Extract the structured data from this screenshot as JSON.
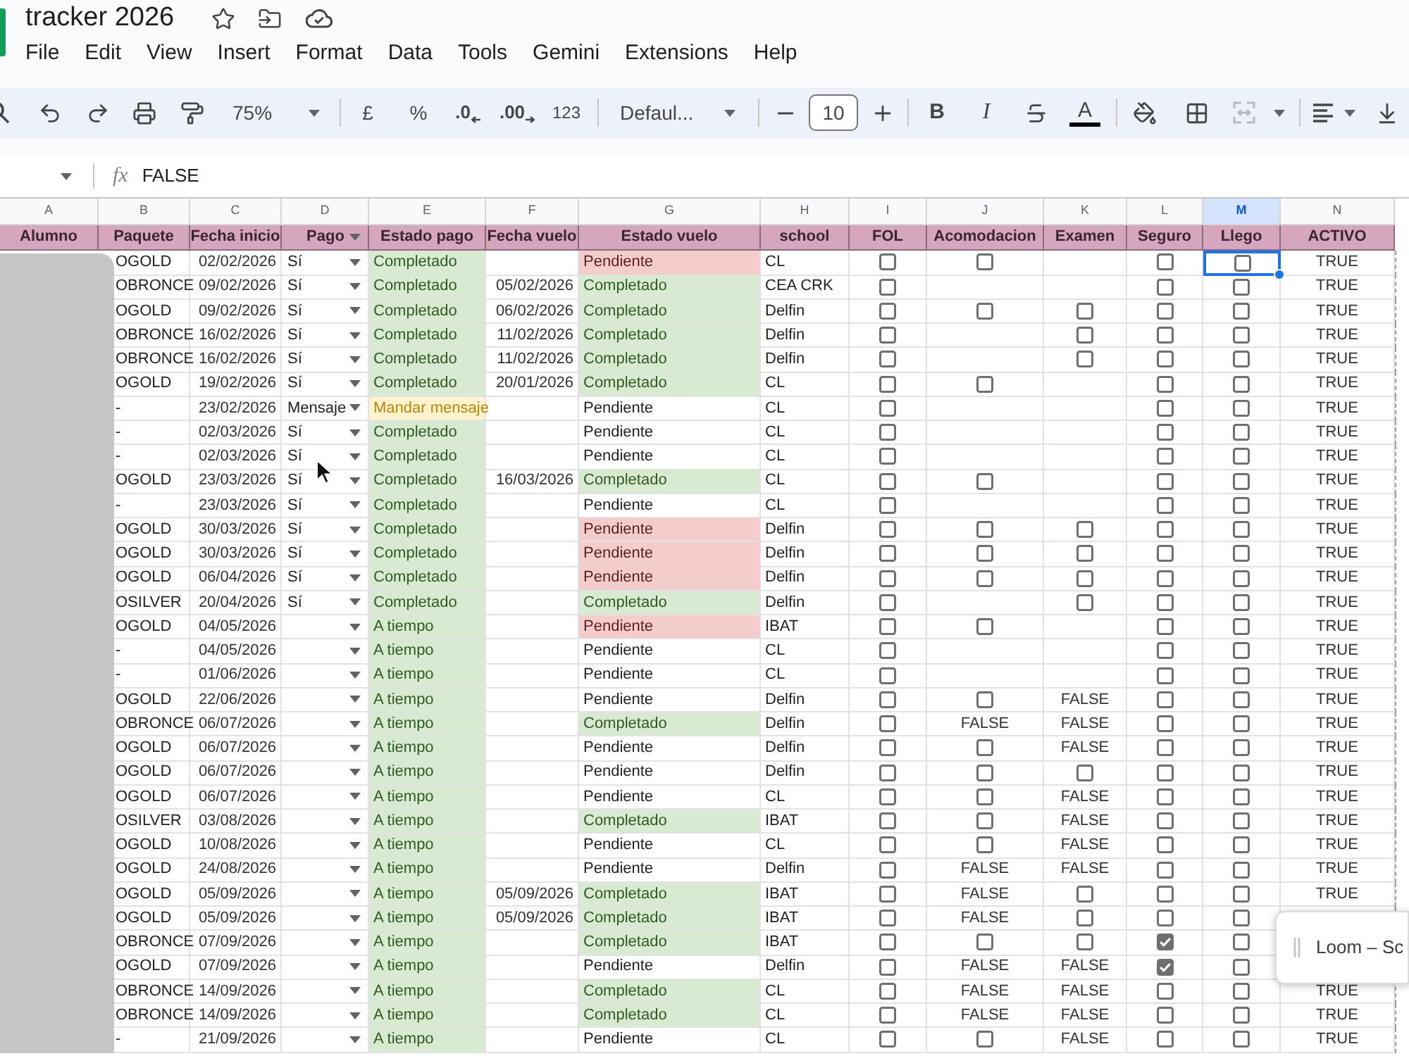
{
  "title": "tracker 2026",
  "menu": [
    "File",
    "Edit",
    "View",
    "Insert",
    "Format",
    "Data",
    "Tools",
    "Gemini",
    "Extensions",
    "Help"
  ],
  "toolbar": {
    "zoom": "75%",
    "currency": "£",
    "percent": "%",
    "decimal_decrease": ".0",
    "decimal_increase": ".00",
    "number_format": "123",
    "font": "Defaul...",
    "font_size": "10",
    "bold": "B",
    "italic": "I",
    "text_color": "A"
  },
  "formula_bar": {
    "fx": "fx",
    "value": "FALSE"
  },
  "table": {
    "columns": [
      {
        "letter": "A",
        "header": "Alumno",
        "selected": false
      },
      {
        "letter": "B",
        "header": "Paquete",
        "selected": false
      },
      {
        "letter": "C",
        "header": "Fecha inicio",
        "selected": false
      },
      {
        "letter": "D",
        "header": "Pago",
        "selected": false,
        "dropdown": true
      },
      {
        "letter": "E",
        "header": "Estado pago",
        "selected": false
      },
      {
        "letter": "F",
        "header": "Fecha vuelo",
        "selected": false
      },
      {
        "letter": "G",
        "header": "Estado vuelo",
        "selected": false
      },
      {
        "letter": "H",
        "header": "school",
        "selected": false
      },
      {
        "letter": "I",
        "header": "FOL",
        "selected": false
      },
      {
        "letter": "J",
        "header": "Acomodacion",
        "selected": false
      },
      {
        "letter": "K",
        "header": "Examen",
        "selected": false
      },
      {
        "letter": "L",
        "header": "Seguro",
        "selected": false
      },
      {
        "letter": "M",
        "header": "Llego",
        "selected": true
      },
      {
        "letter": "N",
        "header": "ACTIVO",
        "selected": false
      }
    ],
    "rows": [
      {
        "paquete": "OGOLD",
        "fecha_inicio": "02/02/2026",
        "pago": "Sí",
        "estado_pago": {
          "text": "Completado",
          "color": "#d9ead3"
        },
        "estado_vuelo": {
          "text": "Pendiente",
          "color": "#f4cccc"
        },
        "school": "CL",
        "fol": {
          "kind": "checkbox",
          "checked": false
        },
        "acomodacion": {
          "kind": "checkbox",
          "checked": false
        },
        "seguro": {
          "kind": "checkbox",
          "checked": false
        },
        "llego": {
          "kind": "checkbox",
          "checked": false,
          "selected": true
        },
        "activo": "TRUE"
      },
      {
        "paquete": "OBRONCE",
        "fecha_inicio": "09/02/2026",
        "pago": "Sí",
        "estado_pago": {
          "text": "Completado",
          "color": "#d9ead3"
        },
        "fecha_vuelo": "05/02/2026",
        "estado_vuelo": {
          "text": "Completado",
          "color": "#d9ead3"
        },
        "school": "CEA CRK",
        "fol": {
          "kind": "checkbox",
          "checked": false
        },
        "seguro": {
          "kind": "checkbox",
          "checked": false
        },
        "llego": {
          "kind": "checkbox",
          "checked": false,
          "selected": false
        },
        "activo": "TRUE"
      },
      {
        "paquete": "OGOLD",
        "fecha_inicio": "09/02/2026",
        "pago": "Sí",
        "estado_pago": {
          "text": "Completado",
          "color": "#d9ead3"
        },
        "fecha_vuelo": "06/02/2026",
        "estado_vuelo": {
          "text": "Completado",
          "color": "#d9ead3"
        },
        "school": "Delfin",
        "fol": {
          "kind": "checkbox",
          "checked": false
        },
        "acomodacion": {
          "kind": "checkbox",
          "checked": false
        },
        "examen": {
          "kind": "checkbox",
          "checked": false
        },
        "seguro": {
          "kind": "checkbox",
          "checked": false
        },
        "llego": {
          "kind": "checkbox",
          "checked": false,
          "selected": false
        },
        "activo": "TRUE"
      },
      {
        "paquete": "OBRONCE",
        "fecha_inicio": "16/02/2026",
        "pago": "Sí",
        "estado_pago": {
          "text": "Completado",
          "color": "#d9ead3"
        },
        "fecha_vuelo": "11/02/2026",
        "estado_vuelo": {
          "text": "Completado",
          "color": "#d9ead3"
        },
        "school": "Delfin",
        "fol": {
          "kind": "checkbox",
          "checked": false
        },
        "examen": {
          "kind": "checkbox",
          "checked": false
        },
        "seguro": {
          "kind": "checkbox",
          "checked": false
        },
        "llego": {
          "kind": "checkbox",
          "checked": false,
          "selected": false
        },
        "activo": "TRUE"
      },
      {
        "paquete": "OBRONCE",
        "fecha_inicio": "16/02/2026",
        "pago": "Sí",
        "estado_pago": {
          "text": "Completado",
          "color": "#d9ead3"
        },
        "fecha_vuelo": "11/02/2026",
        "estado_vuelo": {
          "text": "Completado",
          "color": "#d9ead3"
        },
        "school": "Delfin",
        "fol": {
          "kind": "checkbox",
          "checked": false
        },
        "examen": {
          "kind": "checkbox",
          "checked": false
        },
        "seguro": {
          "kind": "checkbox",
          "checked": false
        },
        "llego": {
          "kind": "checkbox",
          "checked": false,
          "selected": false
        },
        "activo": "TRUE"
      },
      {
        "paquete": "OGOLD",
        "fecha_inicio": "19/02/2026",
        "pago": "Sí",
        "estado_pago": {
          "text": "Completado",
          "color": "#d9ead3"
        },
        "fecha_vuelo": "20/01/2026",
        "estado_vuelo": {
          "text": "Completado",
          "color": "#d9ead3"
        },
        "school": "CL",
        "fol": {
          "kind": "checkbox",
          "checked": false
        },
        "acomodacion": {
          "kind": "checkbox",
          "checked": false
        },
        "seguro": {
          "kind": "checkbox",
          "checked": false
        },
        "llego": {
          "kind": "checkbox",
          "checked": false,
          "selected": false
        },
        "activo": "TRUE"
      },
      {
        "paquete": "-",
        "fecha_inicio": "23/02/2026",
        "pago": "Mensaje",
        "estado_pago": {
          "text": "Mandar mensaje",
          "color": "#fff2cc"
        },
        "estado_vuelo": {
          "text": "Pendiente"
        },
        "school": "CL",
        "fol": {
          "kind": "checkbox",
          "checked": false
        },
        "seguro": {
          "kind": "checkbox",
          "checked": false
        },
        "llego": {
          "kind": "checkbox",
          "checked": false,
          "selected": false
        },
        "activo": "TRUE"
      },
      {
        "paquete": "-",
        "fecha_inicio": "02/03/2026",
        "pago": "Sí",
        "estado_pago": {
          "text": "Completado",
          "color": "#d9ead3"
        },
        "estado_vuelo": {
          "text": "Pendiente"
        },
        "school": "CL",
        "fol": {
          "kind": "checkbox",
          "checked": false
        },
        "seguro": {
          "kind": "checkbox",
          "checked": false
        },
        "llego": {
          "kind": "checkbox",
          "checked": false,
          "selected": false
        },
        "activo": "TRUE"
      },
      {
        "paquete": "-",
        "fecha_inicio": "02/03/2026",
        "pago": "Sí",
        "estado_pago": {
          "text": "Completado",
          "color": "#d9ead3"
        },
        "estado_vuelo": {
          "text": "Pendiente"
        },
        "school": "CL",
        "fol": {
          "kind": "checkbox",
          "checked": false
        },
        "seguro": {
          "kind": "checkbox",
          "checked": false
        },
        "llego": {
          "kind": "checkbox",
          "checked": false,
          "selected": false
        },
        "activo": "TRUE"
      },
      {
        "paquete": "OGOLD",
        "fecha_inicio": "23/03/2026",
        "pago": "Sí",
        "estado_pago": {
          "text": "Completado",
          "color": "#d9ead3"
        },
        "fecha_vuelo": "16/03/2026",
        "estado_vuelo": {
          "text": "Completado",
          "color": "#d9ead3"
        },
        "school": "CL",
        "fol": {
          "kind": "checkbox",
          "checked": false
        },
        "acomodacion": {
          "kind": "checkbox",
          "checked": false
        },
        "seguro": {
          "kind": "checkbox",
          "checked": false
        },
        "llego": {
          "kind": "checkbox",
          "checked": false,
          "selected": false
        },
        "activo": "TRUE"
      },
      {
        "paquete": "-",
        "fecha_inicio": "23/03/2026",
        "pago": "Sí",
        "estado_pago": {
          "text": "Completado",
          "color": "#d9ead3"
        },
        "estado_vuelo": {
          "text": "Pendiente"
        },
        "school": "CL",
        "fol": {
          "kind": "checkbox",
          "checked": false
        },
        "seguro": {
          "kind": "checkbox",
          "checked": false
        },
        "llego": {
          "kind": "checkbox",
          "checked": false,
          "selected": false
        },
        "activo": "TRUE"
      },
      {
        "paquete": "OGOLD",
        "fecha_inicio": "30/03/2026",
        "pago": "Sí",
        "estado_pago": {
          "text": "Completado",
          "color": "#d9ead3"
        },
        "estado_vuelo": {
          "text": "Pendiente",
          "color": "#f4cccc"
        },
        "school": "Delfin",
        "fol": {
          "kind": "checkbox",
          "checked": false
        },
        "acomodacion": {
          "kind": "checkbox",
          "checked": false
        },
        "examen": {
          "kind": "checkbox",
          "checked": false
        },
        "seguro": {
          "kind": "checkbox",
          "checked": false
        },
        "llego": {
          "kind": "checkbox",
          "checked": false,
          "selected": false
        },
        "activo": "TRUE"
      },
      {
        "paquete": "OGOLD",
        "fecha_inicio": "30/03/2026",
        "pago": "Sí",
        "estado_pago": {
          "text": "Completado",
          "color": "#d9ead3"
        },
        "estado_vuelo": {
          "text": "Pendiente",
          "color": "#f4cccc"
        },
        "school": "Delfin",
        "fol": {
          "kind": "checkbox",
          "checked": false
        },
        "acomodacion": {
          "kind": "checkbox",
          "checked": false
        },
        "examen": {
          "kind": "checkbox",
          "checked": false
        },
        "seguro": {
          "kind": "checkbox",
          "checked": false
        },
        "llego": {
          "kind": "checkbox",
          "checked": false,
          "selected": false
        },
        "activo": "TRUE"
      },
      {
        "paquete": "OGOLD",
        "fecha_inicio": "06/04/2026",
        "pago": "Sí",
        "estado_pago": {
          "text": "Completado",
          "color": "#d9ead3"
        },
        "estado_vuelo": {
          "text": "Pendiente",
          "color": "#f4cccc"
        },
        "school": "Delfin",
        "fol": {
          "kind": "checkbox",
          "checked": false
        },
        "acomodacion": {
          "kind": "checkbox",
          "checked": false
        },
        "examen": {
          "kind": "checkbox",
          "checked": false
        },
        "seguro": {
          "kind": "checkbox",
          "checked": false
        },
        "llego": {
          "kind": "checkbox",
          "checked": false,
          "selected": false
        },
        "activo": "TRUE"
      },
      {
        "paquete": "OSILVER",
        "fecha_inicio": "20/04/2026",
        "pago": "Sí",
        "estado_pago": {
          "text": "Completado",
          "color": "#d9ead3"
        },
        "estado_vuelo": {
          "text": "Completado",
          "color": "#d9ead3"
        },
        "school": "Delfin",
        "fol": {
          "kind": "checkbox",
          "checked": false
        },
        "examen": {
          "kind": "checkbox",
          "checked": false
        },
        "seguro": {
          "kind": "checkbox",
          "checked": false
        },
        "llego": {
          "kind": "checkbox",
          "checked": false,
          "selected": false
        },
        "activo": "TRUE"
      },
      {
        "paquete": "OGOLD",
        "fecha_inicio": "04/05/2026",
        "estado_pago": {
          "text": "A tiempo",
          "color": "#d9ead3"
        },
        "estado_vuelo": {
          "text": "Pendiente",
          "color": "#f4cccc"
        },
        "school": "IBAT",
        "fol": {
          "kind": "checkbox",
          "checked": false
        },
        "acomodacion": {
          "kind": "checkbox",
          "checked": false
        },
        "seguro": {
          "kind": "checkbox",
          "checked": false
        },
        "llego": {
          "kind": "checkbox",
          "checked": false,
          "selected": false
        },
        "activo": "TRUE"
      },
      {
        "paquete": "-",
        "fecha_inicio": "04/05/2026",
        "estado_pago": {
          "text": "A tiempo",
          "color": "#d9ead3"
        },
        "estado_vuelo": {
          "text": "Pendiente"
        },
        "school": "CL",
        "fol": {
          "kind": "checkbox",
          "checked": false
        },
        "seguro": {
          "kind": "checkbox",
          "checked": false
        },
        "llego": {
          "kind": "checkbox",
          "checked": false,
          "selected": false
        },
        "activo": "TRUE"
      },
      {
        "paquete": "-",
        "fecha_inicio": "01/06/2026",
        "estado_pago": {
          "text": "A tiempo",
          "color": "#d9ead3"
        },
        "estado_vuelo": {
          "text": "Pendiente"
        },
        "school": "CL",
        "fol": {
          "kind": "checkbox",
          "checked": false
        },
        "seguro": {
          "kind": "checkbox",
          "checked": false
        },
        "llego": {
          "kind": "checkbox",
          "checked": false,
          "selected": false
        },
        "activo": "TRUE"
      },
      {
        "paquete": "OGOLD",
        "fecha_inicio": "22/06/2026",
        "estado_pago": {
          "text": "A tiempo",
          "color": "#d9ead3"
        },
        "estado_vuelo": {
          "text": "Pendiente"
        },
        "school": "Delfin",
        "fol": {
          "kind": "checkbox",
          "checked": false
        },
        "acomodacion": {
          "kind": "checkbox",
          "checked": false
        },
        "examen": {
          "kind": "text",
          "text": "FALSE"
        },
        "seguro": {
          "kind": "checkbox",
          "checked": false
        },
        "llego": {
          "kind": "checkbox",
          "checked": false,
          "selected": false
        },
        "activo": "TRUE"
      },
      {
        "paquete": "OBRONCE",
        "fecha_inicio": "06/07/2026",
        "estado_pago": {
          "text": "A tiempo",
          "color": "#d9ead3"
        },
        "estado_vuelo": {
          "text": "Completado",
          "color": "#d9ead3"
        },
        "school": "Delfin",
        "fol": {
          "kind": "checkbox",
          "checked": false
        },
        "acomodacion": {
          "kind": "text",
          "text": "FALSE"
        },
        "examen": {
          "kind": "text",
          "text": "FALSE"
        },
        "seguro": {
          "kind": "checkbox",
          "checked": false
        },
        "llego": {
          "kind": "checkbox",
          "checked": false,
          "selected": false
        },
        "activo": "TRUE"
      },
      {
        "paquete": "OGOLD",
        "fecha_inicio": "06/07/2026",
        "estado_pago": {
          "text": "A tiempo",
          "color": "#d9ead3"
        },
        "estado_vuelo": {
          "text": "Pendiente"
        },
        "school": "Delfin",
        "fol": {
          "kind": "checkbox",
          "checked": false
        },
        "acomodacion": {
          "kind": "checkbox",
          "checked": false
        },
        "examen": {
          "kind": "text",
          "text": "FALSE"
        },
        "seguro": {
          "kind": "checkbox",
          "checked": false
        },
        "llego": {
          "kind": "checkbox",
          "checked": false,
          "selected": false
        },
        "activo": "TRUE"
      },
      {
        "paquete": "OGOLD",
        "fecha_inicio": "06/07/2026",
        "estado_pago": {
          "text": "A tiempo",
          "color": "#d9ead3"
        },
        "estado_vuelo": {
          "text": "Pendiente"
        },
        "school": "Delfin",
        "fol": {
          "kind": "checkbox",
          "checked": false
        },
        "acomodacion": {
          "kind": "checkbox",
          "checked": false
        },
        "examen": {
          "kind": "checkbox",
          "checked": false
        },
        "seguro": {
          "kind": "checkbox",
          "checked": false
        },
        "llego": {
          "kind": "checkbox",
          "checked": false,
          "selected": false
        },
        "activo": "TRUE"
      },
      {
        "paquete": "OGOLD",
        "fecha_inicio": "06/07/2026",
        "estado_pago": {
          "text": "A tiempo",
          "color": "#d9ead3"
        },
        "estado_vuelo": {
          "text": "Pendiente"
        },
        "school": "CL",
        "fol": {
          "kind": "checkbox",
          "checked": false
        },
        "acomodacion": {
          "kind": "checkbox",
          "checked": false
        },
        "examen": {
          "kind": "text",
          "text": "FALSE"
        },
        "seguro": {
          "kind": "checkbox",
          "checked": false
        },
        "llego": {
          "kind": "checkbox",
          "checked": false,
          "selected": false
        },
        "activo": "TRUE"
      },
      {
        "paquete": "OSILVER",
        "fecha_inicio": "03/08/2026",
        "estado_pago": {
          "text": "A tiempo",
          "color": "#d9ead3"
        },
        "estado_vuelo": {
          "text": "Completado",
          "color": "#d9ead3"
        },
        "school": "IBAT",
        "fol": {
          "kind": "checkbox",
          "checked": false
        },
        "acomodacion": {
          "kind": "checkbox",
          "checked": false
        },
        "examen": {
          "kind": "text",
          "text": "FALSE"
        },
        "seguro": {
          "kind": "checkbox",
          "checked": false
        },
        "llego": {
          "kind": "checkbox",
          "checked": false,
          "selected": false
        },
        "activo": "TRUE"
      },
      {
        "paquete": "OGOLD",
        "fecha_inicio": "10/08/2026",
        "estado_pago": {
          "text": "A tiempo",
          "color": "#d9ead3"
        },
        "estado_vuelo": {
          "text": "Pendiente"
        },
        "school": "CL",
        "fol": {
          "kind": "checkbox",
          "checked": false
        },
        "acomodacion": {
          "kind": "checkbox",
          "checked": false
        },
        "examen": {
          "kind": "text",
          "text": "FALSE"
        },
        "seguro": {
          "kind": "checkbox",
          "checked": false
        },
        "llego": {
          "kind": "checkbox",
          "checked": false,
          "selected": false
        },
        "activo": "TRUE"
      },
      {
        "paquete": "OGOLD",
        "fecha_inicio": "24/08/2026",
        "estado_pago": {
          "text": "A tiempo",
          "color": "#d9ead3"
        },
        "estado_vuelo": {
          "text": "Pendiente"
        },
        "school": "Delfin",
        "fol": {
          "kind": "checkbox",
          "checked": false
        },
        "acomodacion": {
          "kind": "text",
          "text": "FALSE"
        },
        "examen": {
          "kind": "text",
          "text": "FALSE"
        },
        "seguro": {
          "kind": "checkbox",
          "checked": false
        },
        "llego": {
          "kind": "checkbox",
          "checked": false,
          "selected": false
        },
        "activo": "TRUE"
      },
      {
        "paquete": "OGOLD",
        "fecha_inicio": "05/09/2026",
        "estado_pago": {
          "text": "A tiempo",
          "color": "#d9ead3"
        },
        "fecha_vuelo": "05/09/2026",
        "estado_vuelo": {
          "text": "Completado",
          "color": "#d9ead3"
        },
        "school": "IBAT",
        "fol": {
          "kind": "checkbox",
          "checked": false
        },
        "acomodacion": {
          "kind": "text",
          "text": "FALSE"
        },
        "examen": {
          "kind": "checkbox",
          "checked": false
        },
        "seguro": {
          "kind": "checkbox",
          "checked": false
        },
        "llego": {
          "kind": "checkbox",
          "checked": false,
          "selected": false
        },
        "activo": "TRUE"
      },
      {
        "paquete": "OGOLD",
        "fecha_inicio": "05/09/2026",
        "estado_pago": {
          "text": "A tiempo",
          "color": "#d9ead3"
        },
        "fecha_vuelo": "05/09/2026",
        "estado_vuelo": {
          "text": "Completado",
          "color": "#d9ead3"
        },
        "school": "IBAT",
        "fol": {
          "kind": "checkbox",
          "checked": false
        },
        "acomodacion": {
          "kind": "text",
          "text": "FALSE"
        },
        "examen": {
          "kind": "checkbox",
          "checked": false
        },
        "seguro": {
          "kind": "checkbox",
          "checked": false
        },
        "llego": {
          "kind": "checkbox",
          "checked": false,
          "selected": false
        }
      },
      {
        "paquete": "OBRONCE",
        "fecha_inicio": "07/09/2026",
        "estado_pago": {
          "text": "A tiempo",
          "color": "#d9ead3"
        },
        "estado_vuelo": {
          "text": "Completado",
          "color": "#d9ead3"
        },
        "school": "IBAT",
        "fol": {
          "kind": "checkbox",
          "checked": false
        },
        "acomodacion": {
          "kind": "checkbox",
          "checked": false
        },
        "examen": {
          "kind": "checkbox",
          "checked": false
        },
        "seguro": {
          "kind": "checkbox",
          "checked": true
        },
        "llego": {
          "kind": "checkbox",
          "checked": false,
          "selected": false
        }
      },
      {
        "paquete": "OGOLD",
        "fecha_inicio": "07/09/2026",
        "estado_pago": {
          "text": "A tiempo",
          "color": "#d9ead3"
        },
        "estado_vuelo": {
          "text": "Pendiente"
        },
        "school": "Delfin",
        "fol": {
          "kind": "checkbox",
          "checked": false
        },
        "acomodacion": {
          "kind": "text",
          "text": "FALSE"
        },
        "examen": {
          "kind": "text",
          "text": "FALSE"
        },
        "seguro": {
          "kind": "checkbox",
          "checked": true
        },
        "llego": {
          "kind": "checkbox",
          "checked": false,
          "selected": false
        }
      },
      {
        "paquete": "OBRONCE",
        "fecha_inicio": "14/09/2026",
        "estado_pago": {
          "text": "A tiempo",
          "color": "#d9ead3"
        },
        "estado_vuelo": {
          "text": "Completado",
          "color": "#d9ead3"
        },
        "school": "CL",
        "fol": {
          "kind": "checkbox",
          "checked": false
        },
        "acomodacion": {
          "kind": "text",
          "text": "FALSE"
        },
        "examen": {
          "kind": "text",
          "text": "FALSE"
        },
        "seguro": {
          "kind": "checkbox",
          "checked": false
        },
        "llego": {
          "kind": "checkbox",
          "checked": false,
          "selected": false
        },
        "activo": "TRUE"
      },
      {
        "paquete": "OBRONCE",
        "fecha_inicio": "14/09/2026",
        "estado_pago": {
          "text": "A tiempo",
          "color": "#d9ead3"
        },
        "estado_vuelo": {
          "text": "Completado",
          "color": "#d9ead3"
        },
        "school": "CL",
        "fol": {
          "kind": "checkbox",
          "checked": false
        },
        "acomodacion": {
          "kind": "text",
          "text": "FALSE"
        },
        "examen": {
          "kind": "text",
          "text": "FALSE"
        },
        "seguro": {
          "kind": "checkbox",
          "checked": false
        },
        "llego": {
          "kind": "checkbox",
          "checked": false,
          "selected": false
        },
        "activo": "TRUE"
      },
      {
        "paquete": "-",
        "fecha_inicio": "21/09/2026",
        "estado_pago": {
          "text": "A tiempo",
          "color": "#d9ead3"
        },
        "estado_vuelo": {
          "text": "Pendiente"
        },
        "school": "CL",
        "fol": {
          "kind": "checkbox",
          "checked": false
        },
        "acomodacion": {
          "kind": "checkbox",
          "checked": false
        },
        "examen": {
          "kind": "text",
          "text": "FALSE"
        },
        "seguro": {
          "kind": "checkbox",
          "checked": false
        },
        "llego": {
          "kind": "checkbox",
          "checked": false,
          "selected": false
        },
        "activo": "TRUE"
      }
    ]
  },
  "floating_panel": {
    "title": "Loom – Sc"
  }
}
